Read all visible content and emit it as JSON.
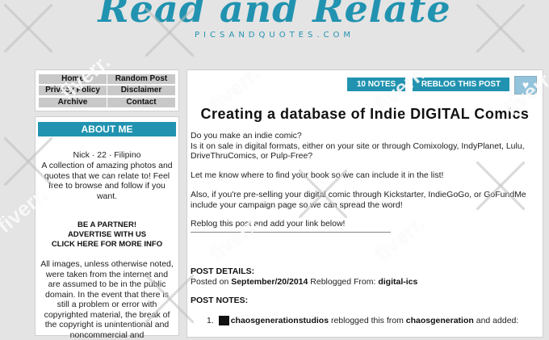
{
  "header": {
    "logo": "Read and Relate",
    "tagline": "PICSANDQUOTES.COM"
  },
  "nav": {
    "home": "Home",
    "random_post": "Random Post",
    "privacy_policy": "Privacy Policy",
    "disclaimer": "Disclaimer",
    "archive": "Archive",
    "contact": "Contact"
  },
  "about": {
    "title": "ABOUT ME",
    "bio_line": "Nick · 22 · Filipino",
    "bio_text": "A collection of amazing photos and quotes that we can relate to! Feel free to browse and follow if you want.",
    "partner_1": "BE A PARTNER!",
    "partner_2": "ADVERTISE WITH US",
    "partner_3": "CLICK HERE FOR MORE INFO",
    "disclaimer_text": "All images, unless otherwise noted, were taken from the internet and are assumed to be in the public domain. In the event that there is still a problem or error with copyrighted material, the break of the copyright is unintentional and noncommercial and"
  },
  "post": {
    "notes_label": "10 NOTES",
    "reblog_label": "REBLOG THIS POST",
    "heart_glyph": "♥",
    "title": "Creating a database of Indie DIGITAL Comics",
    "para1": "Do you make an indie comic?\nIs it on sale in digital formats, either on your site or through Comixology, IndyPlanet, Lulu, DriveThruComics, or Pulp-Free?",
    "para2": "Let me know where to find your book so we can include it in the list!",
    "para3": "Also, if you're pre-selling your digital comic through Kickstarter, IndieGoGo, or GoFundMe include your campaign page so we can spread the word!",
    "para4": "Reblog this post and add your link below!",
    "details_head": "POST DETAILS:",
    "posted_on_label": "Posted on",
    "posted_on": "September/20/2014",
    "reblogged_from_label": "Reblogged From:",
    "reblogged_from": "digital-ics",
    "notes_head": "POST NOTES:",
    "note_1_num": "1.",
    "note_1_user": "chaosgenerationstudios",
    "note_1_action": "reblogged this from",
    "note_1_source": "chaosgeneration",
    "note_1_tail": "and added:"
  },
  "watermark": "fiverr.",
  "colors": {
    "accent": "#2193b0",
    "background": "#e4e4e4",
    "nav_button": "#c8c8c8"
  }
}
